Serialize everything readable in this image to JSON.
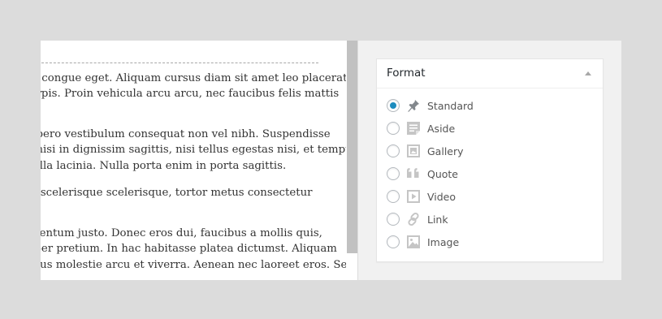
{
  "editor": {
    "paragraphs": [
      [
        "si congue eget. Aliquam cursus diam sit amet leo placerat",
        "urpis. Proin vehicula arcu arcu, nec faucibus felis mattis"
      ],
      [
        "libero vestibulum consequat non vel nibh. Suspendisse",
        ", nisi in dignissim sagittis, nisi tellus egestas nisi, et tempus",
        "gilla lacinia. Nulla porta enim in porta sagittis."
      ],
      [
        "it scelerisque scelerisque, tortor metus consectetur"
      ],
      [
        "mentum justo. Donec eros dui, faucibus a mollis quis,",
        "rper pretium. In hac habitasse platea dictumst. Aliquam",
        "rsus molestie arcu et viverra. Aenean nec laoreet eros. Sed"
      ]
    ]
  },
  "format_panel": {
    "title": "Format",
    "selected": "Standard",
    "options": [
      {
        "label": "Standard",
        "icon": "pin-icon"
      },
      {
        "label": "Aside",
        "icon": "aside-icon"
      },
      {
        "label": "Gallery",
        "icon": "gallery-icon"
      },
      {
        "label": "Quote",
        "icon": "quote-icon"
      },
      {
        "label": "Video",
        "icon": "video-icon"
      },
      {
        "label": "Link",
        "icon": "link-icon"
      },
      {
        "label": "Image",
        "icon": "image-icon"
      }
    ]
  },
  "colors": {
    "accent": "#1e8cbe",
    "icon_gray": "#c5c5c5",
    "standard_icon": "#82878c"
  }
}
